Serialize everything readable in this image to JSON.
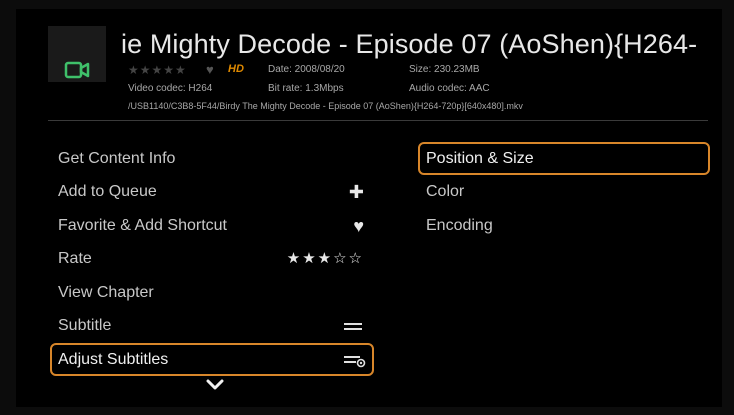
{
  "header": {
    "title": "ie Mighty Decode - Episode 07 (AoShen){H264-",
    "rating_stars": "★★★★★",
    "favorite_glyph": "♥",
    "hd_badge": "HD",
    "date": "Date: 2008/08/20",
    "size": "Size: 230.23MB",
    "video_codec": "Video codec: H264",
    "bit_rate": "Bit rate: 1.3Mbps",
    "audio_codec": "Audio codec: AAC",
    "path": "/USB1140/C3B8-5F44/Birdy The Mighty Decode - Episode 07 (AoShen){H264-720p}[640x480].mkv"
  },
  "left_menu": {
    "items": [
      {
        "label": "Get Content Info"
      },
      {
        "label": "Add to Queue",
        "icon": "plus-icon",
        "glyph": "✚"
      },
      {
        "label": "Favorite & Add Shortcut",
        "icon": "heart-icon",
        "glyph": "♥"
      },
      {
        "label": "Rate",
        "stars": "★★★☆☆",
        "rating": 3
      },
      {
        "label": "View Chapter"
      },
      {
        "label": "Subtitle",
        "icon": "subtitle-icon"
      },
      {
        "label": "Adjust Subtitles",
        "icon": "adjust-subtitle-icon",
        "selected": true
      }
    ]
  },
  "right_menu": {
    "items": [
      {
        "label": "Position & Size",
        "selected": true
      },
      {
        "label": "Color"
      },
      {
        "label": "Encoding"
      }
    ]
  },
  "colors": {
    "accent": "#d8862a",
    "hd_badge": "#e08a00",
    "video_icon": "#3fc06a",
    "background": "#000000"
  },
  "icons": {
    "scroll_down": "chevron-down-icon",
    "media_type": "video-camera-icon"
  }
}
